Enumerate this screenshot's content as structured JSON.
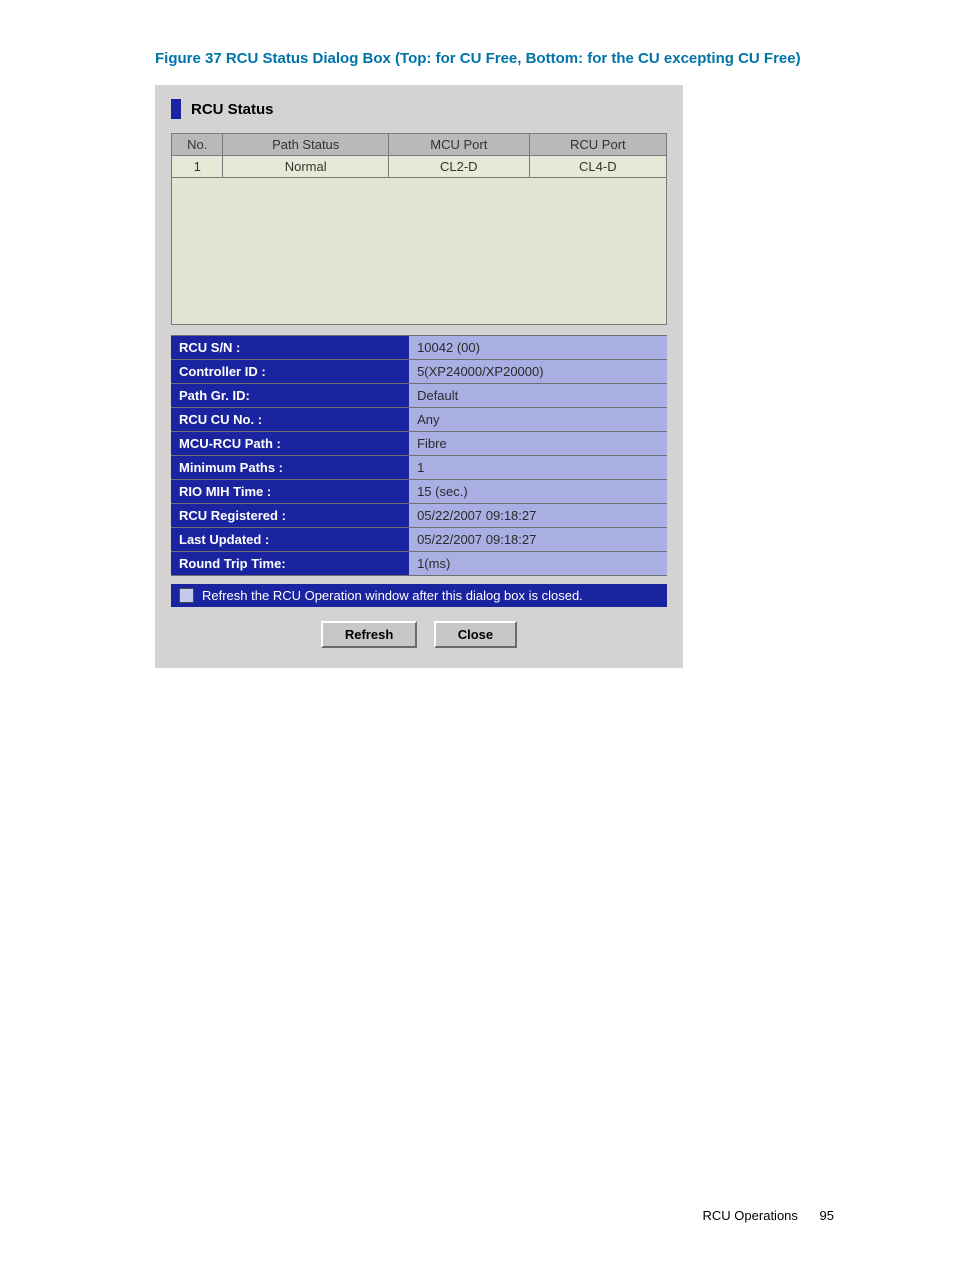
{
  "caption": "Figure 37 RCU Status Dialog Box (Top: for CU Free, Bottom: for the CU excepting CU Free)",
  "dialog": {
    "title": "RCU Status",
    "path_table": {
      "headers": [
        "No.",
        "Path Status",
        "MCU Port",
        "RCU Port"
      ],
      "rows": [
        {
          "no": "1",
          "path_status": "Normal",
          "mcu_port": "CL2-D",
          "rcu_port": "CL4-D"
        }
      ]
    },
    "kv": [
      {
        "key": "RCU S/N :",
        "val": "10042 (00)"
      },
      {
        "key": "Controller ID :",
        "val": "5(XP24000/XP20000)"
      },
      {
        "key": "Path Gr. ID:",
        "val": "Default"
      },
      {
        "key": "RCU CU No. :",
        "val": "Any"
      },
      {
        "key": "MCU-RCU Path :",
        "val": "Fibre"
      },
      {
        "key": "Minimum Paths :",
        "val": "1"
      },
      {
        "key": "RIO MIH Time :",
        "val": "15 (sec.)"
      },
      {
        "key": "RCU Registered :",
        "val": "05/22/2007 09:18:27"
      },
      {
        "key": "Last Updated :",
        "val": "05/22/2007 09:18:27"
      },
      {
        "key": "Round Trip Time:",
        "val": "1(ms)"
      }
    ],
    "checkbox_label": "Refresh the RCU Operation window after this dialog box is closed.",
    "buttons": {
      "refresh": "Refresh",
      "close": "Close"
    }
  },
  "footer": {
    "section": "RCU Operations",
    "page": "95"
  }
}
